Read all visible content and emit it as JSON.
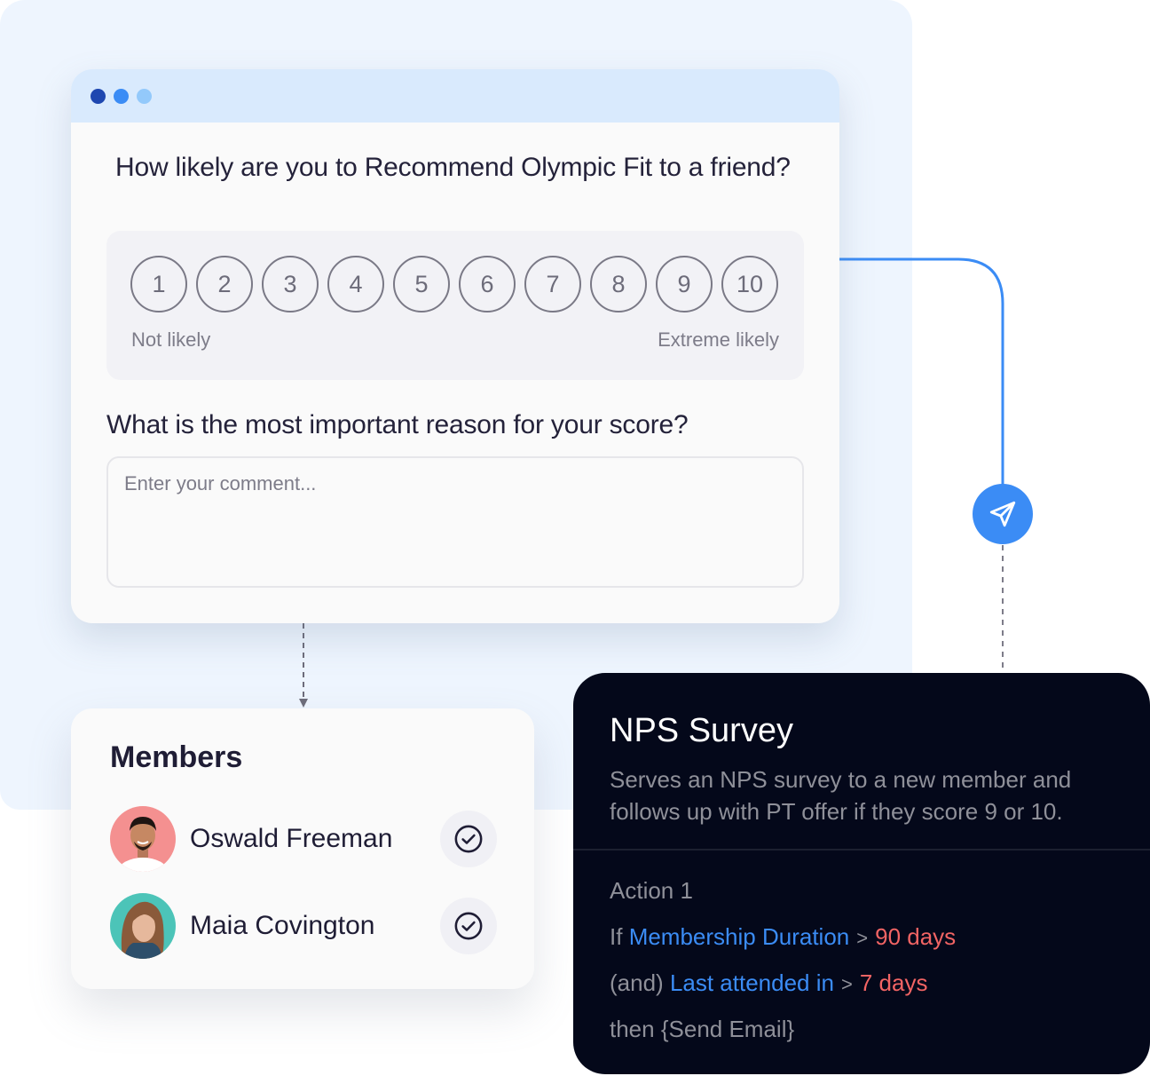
{
  "colors": {
    "accent_blue": "#3b8cf5",
    "accent_red": "#f26464",
    "window_dots": [
      "#1e47b0",
      "#3b8cf5",
      "#93c9fb"
    ],
    "dark_card_bg": "#04081a",
    "panel_bg": "#eef5fe"
  },
  "survey": {
    "window_controls": [
      "dot-dark-blue",
      "dot-blue",
      "dot-light-blue"
    ],
    "question_1": "How likely are you to Recommend Olympic Fit to a friend?",
    "ratings": [
      "1",
      "2",
      "3",
      "4",
      "5",
      "6",
      "7",
      "8",
      "9",
      "10"
    ],
    "scale_low_label": "Not likely",
    "scale_high_label": "Extreme likely",
    "question_2": "What is the most important reason for your score?",
    "comment": {
      "value": "",
      "placeholder": "Enter your comment..."
    }
  },
  "connector": {
    "node_icon": "send-paper-plane-icon"
  },
  "members": {
    "title": "Members",
    "items": [
      {
        "name": "Oswald Freeman",
        "avatar_bg": "#f49090",
        "status_icon": "check-circle-icon"
      },
      {
        "name": "Maia Covington",
        "avatar_bg": "#4cc4b8",
        "status_icon": "check-circle-icon"
      }
    ]
  },
  "nps": {
    "title": "NPS Survey",
    "description": "Serves an NPS survey to a new member and follows up with PT offer if they score 9 or 10.",
    "action_label": "Action 1",
    "rule_1": {
      "prefix": "If",
      "field": "Membership Duration",
      "operator": ">",
      "value": "90 days"
    },
    "rule_2": {
      "prefix": "(and)",
      "field": "Last attended in",
      "operator": ">",
      "value": "7 days"
    },
    "then": "then {Send Email}"
  }
}
